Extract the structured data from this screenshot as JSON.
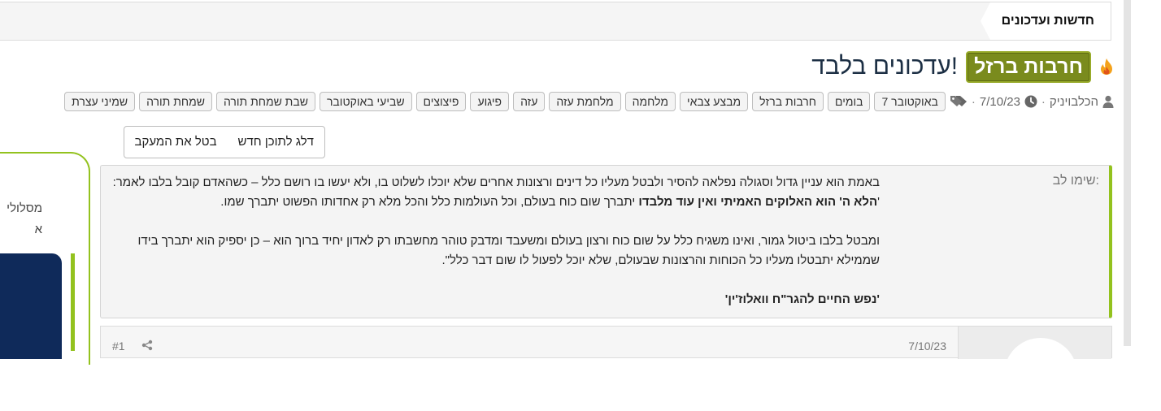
{
  "breadcrumb": {
    "label": "חדשות ועדכונים"
  },
  "thread": {
    "prefix": "חרבות ברזל",
    "title": "עדכונים בלבד!",
    "fire_icon": "fire-icon",
    "author": "הכלבויניק",
    "date": "7/10/23",
    "separator": "·",
    "tags": [
      "7 באוקטובר",
      "בומים",
      "חרבות ברזל",
      "מבצע צבאי",
      "מלחמה",
      "מלחמת עזה",
      "עזה",
      "פיגוע",
      "פיצוצים",
      "שביעי באוקטובר",
      "שבת שמחת תורה",
      "שמחת תורה",
      "שמיני עצרת"
    ]
  },
  "buttons": {
    "skip_new": "דלג לתוכן חדש",
    "unwatch": "בטל את המעקב"
  },
  "notice": {
    "label": "שימו לב:",
    "p1_a": "באמת הוא עניין גדול וסגולה נפלאה להסיר ולבטל מעליו כל דינים ורצונות אחרים שלא יוכלו לשלוט בו, ולא יעשו בו רושם כלל – כשהאדם קובל בלבו לאמר: '",
    "p1_bold": "הלא ה' הוא האלוקים האמיתי ואין עוד מלבדו",
    "p1_b": " יתברך שום כוח בעולם, וכל העולמות כלל והכל מלא רק אחדותו הפשוט יתברך שמו.",
    "p2": "ומבטל בלבו ביטול גמור, ואינו משגיח כלל על שום כוח ורצון בעולם ומשעבד ומדבק טוהר מחשבתו רק לאדון יחיד ברוך הוא – כן יספיק הוא יתברך בידו שממילא יתבטלו מעליו כל הכוחות והרצונות שבעולם, שלא יוכל לפעול לו שום דבר כלל\".",
    "source": "'נפש החיים להגר\"ח וואלוז'ין'"
  },
  "side": {
    "line1": "מסלולי",
    "line2": "א"
  },
  "post": {
    "date": "7/10/23",
    "number": "#1"
  },
  "colors": {
    "accent": "#93c21e",
    "prefix_bg": "#7a8b1d",
    "title": "#1c2f44",
    "dark_panel": "#0f2a5a"
  }
}
